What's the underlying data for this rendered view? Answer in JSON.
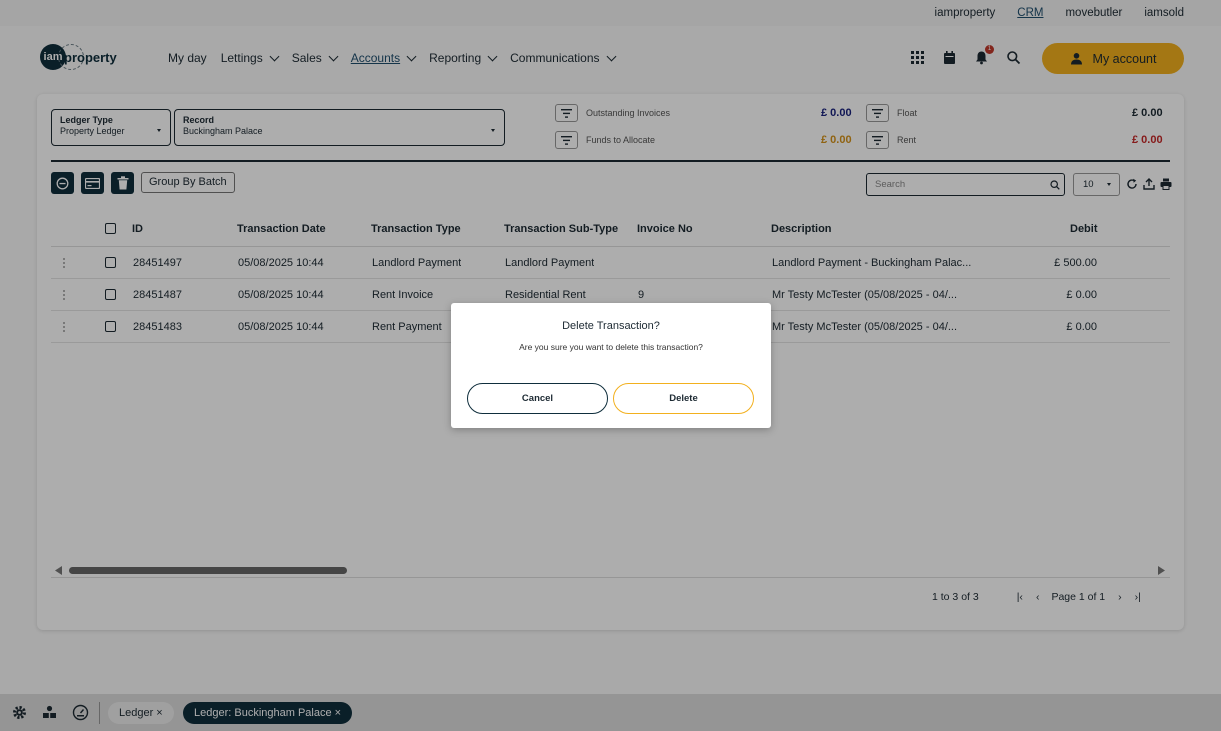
{
  "top_sites": [
    "iamproperty",
    "CRM",
    "movebutler",
    "iamsold"
  ],
  "logo": {
    "mark": "iam",
    "word": "property"
  },
  "nav": [
    {
      "label": "My day",
      "dropdown": false
    },
    {
      "label": "Lettings",
      "dropdown": true
    },
    {
      "label": "Sales",
      "dropdown": true
    },
    {
      "label": "Accounts",
      "dropdown": true,
      "active": true
    },
    {
      "label": "Reporting",
      "dropdown": true
    },
    {
      "label": "Communications",
      "dropdown": true
    }
  ],
  "header_icons": [
    "apps-grid-icon",
    "calendar-icon",
    "bell-icon",
    "search-icon"
  ],
  "notification_count": "1",
  "my_account_label": "My account",
  "ledger_type": {
    "label": "Ledger Type",
    "value": "Property Ledger"
  },
  "record": {
    "label": "Record",
    "value": "Buckingham Palace"
  },
  "summary": {
    "outstanding_invoices": {
      "label": "Outstanding Invoices",
      "value": "£ 0.00",
      "color": "#1a237e"
    },
    "funds_to_allocate": {
      "label": "Funds to Allocate",
      "value": "£ 0.00",
      "color": "#d4931a"
    },
    "float": {
      "label": "Float",
      "value": "£ 0.00",
      "color": "#1d2a33"
    },
    "rent": {
      "label": "Rent",
      "value": "£ 0.00",
      "color": "#c62828"
    }
  },
  "toolbar": {
    "group_by_batch": "Group By Batch",
    "search_placeholder": "Search",
    "page_size": "10"
  },
  "columns": [
    "ID",
    "Transaction Date",
    "Transaction Type",
    "Transaction Sub-Type",
    "Invoice No",
    "Description",
    "Debit"
  ],
  "rows": [
    {
      "id": "28451497",
      "date": "05/08/2025 10:44",
      "type": "Landlord Payment",
      "subtype": "Landlord Payment",
      "invoice": "",
      "description": "Landlord Payment - Buckingham Palac...",
      "debit": "£ 500.00"
    },
    {
      "id": "28451487",
      "date": "05/08/2025 10:44",
      "type": "Rent Invoice",
      "subtype": "Residential Rent",
      "invoice": "9",
      "description": "Mr Testy McTester (05/08/2025 - 04/...",
      "debit": "£ 0.00"
    },
    {
      "id": "28451483",
      "date": "05/08/2025 10:44",
      "type": "Rent Payment",
      "subtype": "",
      "invoice": "",
      "description": "Mr Testy McTester (05/08/2025 - 04/...",
      "debit": "£ 0.00"
    }
  ],
  "pagination": {
    "range": "1 to 3 of 3",
    "page": "Page 1 of 1"
  },
  "bottom_tabs": [
    "Ledger ×",
    "Ledger: Buckingham Palace ×"
  ],
  "modal": {
    "title": "Delete Transaction?",
    "message": "Are you sure you want to delete this transaction?",
    "cancel": "Cancel",
    "delete": "Delete"
  }
}
